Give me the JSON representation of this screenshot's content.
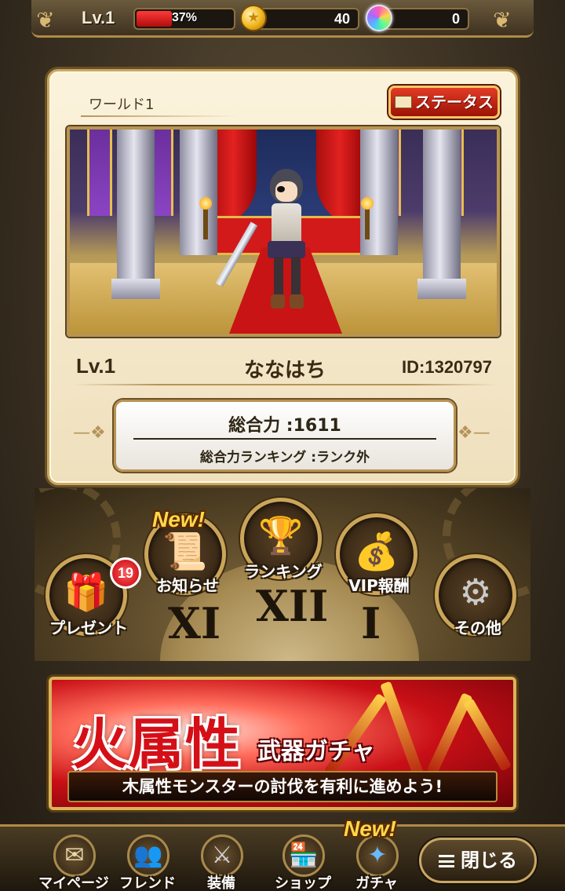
{
  "topbar": {
    "level": "Lv.1",
    "exp_percent_label": "37%",
    "exp_fraction": 0.37,
    "coins": "40",
    "gems": "0"
  },
  "profile": {
    "world": "ワールド1",
    "status_button": "ステータス",
    "level": "Lv.1",
    "name": "ななはち",
    "id": "ID:1320797",
    "power_label": "総合力 :1611",
    "ranking_label": "総合力ランキング :ランク外"
  },
  "menu": {
    "new_tag": "New!",
    "present": "プレゼント",
    "present_badge": "19",
    "news": "お知らせ",
    "ranking": "ランキング",
    "vip": "VIP報酬",
    "other": "その他",
    "numerals": [
      "XI",
      "XII",
      "I"
    ]
  },
  "banner": {
    "title": "火属性",
    "subtitle": "武器ガチャ",
    "description": "木属性モンスターの討伐を有利に進めよう!"
  },
  "nav": {
    "mypage": "マイページ",
    "friend": "フレンド",
    "equip": "装備",
    "shop": "ショップ",
    "gacha": "ガチャ",
    "gacha_new": "New!",
    "close": "閉じる"
  },
  "colors": {
    "accent_gold": "#c9a865",
    "exp_red": "#e32121",
    "banner_red": "#c80f16"
  }
}
